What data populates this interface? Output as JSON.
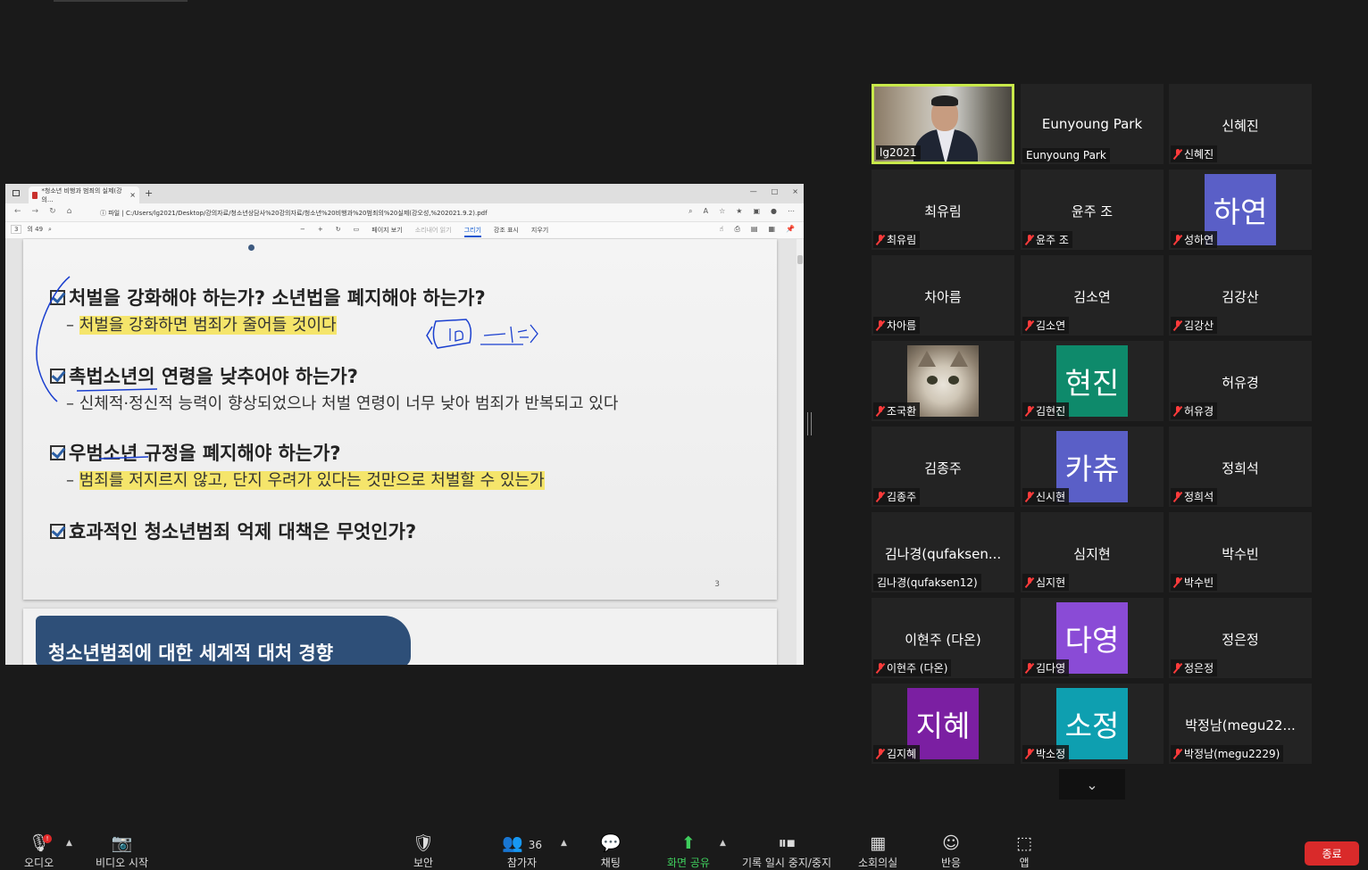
{
  "browser": {
    "tab_title": "*청소년 비행과 범죄의 실제(강의...",
    "tab_close": "×",
    "new_tab": "+",
    "window_buttons": [
      "—",
      "□",
      "×"
    ],
    "address_label": "파일",
    "url": "C:/Users/lg2021/Desktop/강의자료/청소년상담사%20강의자료/청소년%20비행과%20범죄의%20실제(강오성,%202021.9.2).pdf"
  },
  "pdf_toolbar": {
    "page_current": "3",
    "page_total": "의 49",
    "page_view": "페이지 보기",
    "read_aloud": "소리내어 읽기",
    "draw": "그리기",
    "highlight": "강조 표시",
    "erase": "지우기"
  },
  "slide": {
    "q1": "처벌을 강화해야 하는가? 소년법을 폐지해야 하는가?",
    "s1": "처벌을 강화하면 범죄가 줄어들 것이다",
    "s1_dash": "–",
    "q2": "촉법소년의 연령을 낮추어야 하는가?",
    "s2": "신체적·정신적 능력이 향상되었으나 처벌 연령이 너무 낮아 범죄가 반복되고 있다",
    "s2_dash": "–",
    "q3": "우범소년 규정을 폐지해야 하는가?",
    "s3": "범죄를 저지르지 않고, 단지 우려가 있다는 것만으로 처벌할 수 있는가",
    "s3_dash": "–",
    "q4": "효과적인 청소년범죄 억제 대책은 무엇인가?",
    "page_number": "3",
    "next_title": "청소년범죄에 대한 세계적 대처 경향"
  },
  "gallery": {
    "tiles": [
      {
        "big": "",
        "label": "lg2021",
        "avatar": "",
        "color": "",
        "muted": false
      },
      {
        "big": "Eunyoung Park",
        "label": "Eunyoung Park",
        "avatar": "",
        "color": "",
        "muted": false
      },
      {
        "big": "신혜진",
        "label": "신혜진",
        "avatar": "",
        "color": "",
        "muted": true
      },
      {
        "big": "최유림",
        "label": "최유림",
        "avatar": "",
        "color": "",
        "muted": true
      },
      {
        "big": "윤주 조",
        "label": "윤주 조",
        "avatar": "",
        "color": "",
        "muted": true
      },
      {
        "big": "",
        "label": "성하연",
        "avatar": "하연",
        "color": "#5a5fc7",
        "muted": true
      },
      {
        "big": "차아름",
        "label": "차아름",
        "avatar": "",
        "color": "",
        "muted": true
      },
      {
        "big": "김소연",
        "label": "김소연",
        "avatar": "",
        "color": "",
        "muted": true
      },
      {
        "big": "김강산",
        "label": "김강산",
        "avatar": "",
        "color": "",
        "muted": true
      },
      {
        "big": "",
        "label": "조국환",
        "avatar": "",
        "color": "",
        "muted": true
      },
      {
        "big": "",
        "label": "김현진",
        "avatar": "현진",
        "color": "#0e8a6b",
        "muted": true
      },
      {
        "big": "허유경",
        "label": "허유경",
        "avatar": "",
        "color": "",
        "muted": true
      },
      {
        "big": "김종주",
        "label": "김종주",
        "avatar": "",
        "color": "",
        "muted": true
      },
      {
        "big": "",
        "label": "신시현",
        "avatar": "카츄",
        "color": "#5a5fc7",
        "muted": true
      },
      {
        "big": "정희석",
        "label": "정희석",
        "avatar": "",
        "color": "",
        "muted": true
      },
      {
        "big": "김나경(qufaksen...",
        "label": "김나경(qufaksen12)",
        "avatar": "",
        "color": "",
        "muted": false
      },
      {
        "big": "심지현",
        "label": "심지현",
        "avatar": "",
        "color": "",
        "muted": true
      },
      {
        "big": "박수빈",
        "label": "박수빈",
        "avatar": "",
        "color": "",
        "muted": true
      },
      {
        "big": "이현주 (다온)",
        "label": "이현주 (다온)",
        "avatar": "",
        "color": "",
        "muted": true
      },
      {
        "big": "",
        "label": "김다영",
        "avatar": "다영",
        "color": "#8a4bd6",
        "muted": true
      },
      {
        "big": "정은정",
        "label": "정은정",
        "avatar": "",
        "color": "",
        "muted": true
      },
      {
        "big": "",
        "label": "김지혜",
        "avatar": "지혜",
        "color": "#7b1fa2",
        "muted": true
      },
      {
        "big": "",
        "label": "박소정",
        "avatar": "소정",
        "color": "#0e9fb0",
        "muted": true
      },
      {
        "big": "박정남(megu22...",
        "label": "박정남(megu2229)",
        "avatar": "",
        "color": "",
        "muted": true
      }
    ]
  },
  "toolbar": {
    "audio": "오디오",
    "video": "비디오 시작",
    "security": "보안",
    "participants": "참가자",
    "participants_count": "36",
    "chat": "채팅",
    "share": "화면 공유",
    "record": "기록 일시 중지/중지",
    "breakout": "소회의실",
    "reactions": "반응",
    "apps": "앱",
    "end": "종료",
    "audio_badge": "!"
  }
}
